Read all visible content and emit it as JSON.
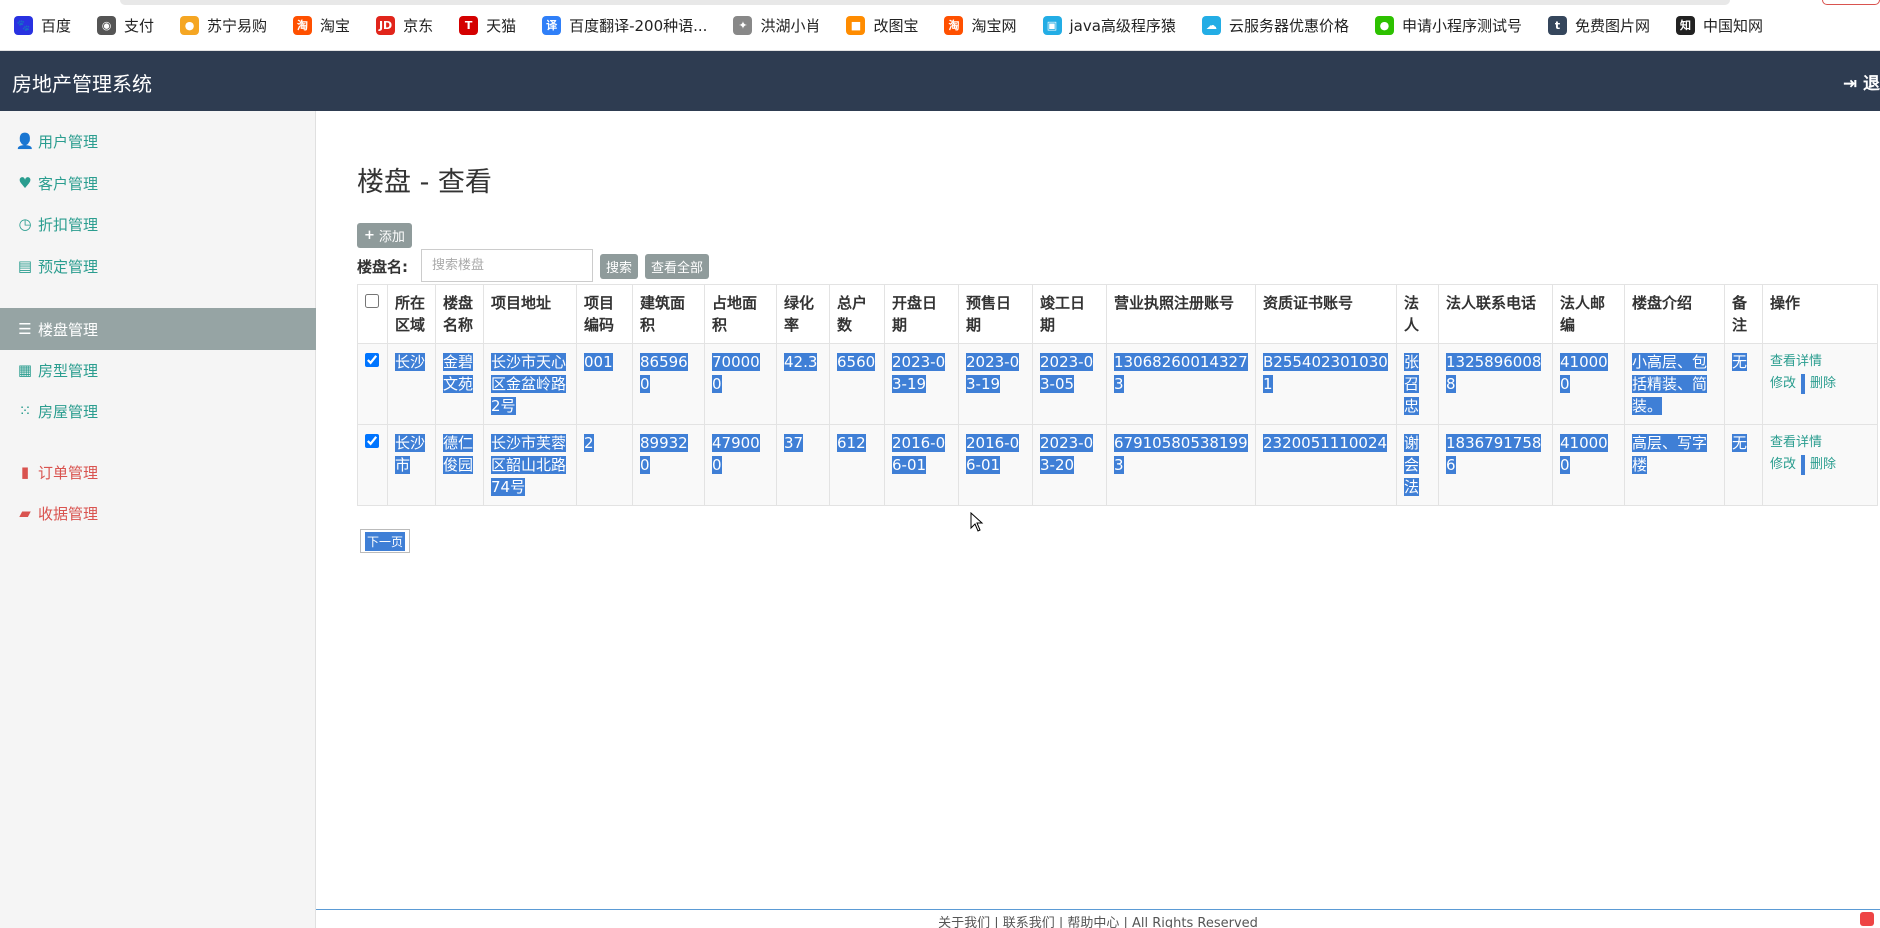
{
  "bookmarks": [
    {
      "label": "百度",
      "icon": "baidu-icon",
      "color": "#2932e1",
      "glyph": "🐾"
    },
    {
      "label": "支付",
      "icon": "globe-icon",
      "color": "#555555",
      "glyph": "◉"
    },
    {
      "label": "苏宁易购",
      "icon": "suning-icon",
      "color": "#f5a623",
      "glyph": "●"
    },
    {
      "label": "淘宝",
      "icon": "taobao-icon",
      "color": "#ff5000",
      "glyph": "淘"
    },
    {
      "label": "京东",
      "icon": "jd-icon",
      "color": "#e1251b",
      "glyph": "JD"
    },
    {
      "label": "天猫",
      "icon": "tmall-icon",
      "color": "#d40000",
      "glyph": "T"
    },
    {
      "label": "百度翻译-200种语...",
      "icon": "translate-icon",
      "color": "#2f7ff8",
      "glyph": "译"
    },
    {
      "label": "洪湖小肖",
      "icon": "ghost-icon",
      "color": "#888888",
      "glyph": "✦"
    },
    {
      "label": "改图宝",
      "icon": "gaitubao-icon",
      "color": "#ff8c00",
      "glyph": "■"
    },
    {
      "label": "淘宝网",
      "icon": "taobao2-icon",
      "color": "#ff5000",
      "glyph": "淘"
    },
    {
      "label": "java高级程序猿",
      "icon": "bilibili-icon",
      "color": "#23ade5",
      "glyph": "▣"
    },
    {
      "label": "云服务器优惠价格",
      "icon": "cloud-icon",
      "color": "#23ade5",
      "glyph": "☁"
    },
    {
      "label": "申请小程序测试号",
      "icon": "wechat-icon",
      "color": "#2dc100",
      "glyph": "●"
    },
    {
      "label": "免费图片网",
      "icon": "tumblr-icon",
      "color": "#35465c",
      "glyph": "t"
    },
    {
      "label": "中国知网",
      "icon": "cnki-icon",
      "color": "#222222",
      "glyph": "知"
    }
  ],
  "header": {
    "title": "房地产管理系统",
    "logout": "退"
  },
  "sidebar": {
    "items": [
      {
        "label": "用户管理",
        "icon": "user-icon",
        "glyph": "👤"
      },
      {
        "label": "客户管理",
        "icon": "heart-icon",
        "glyph": "♥"
      },
      {
        "label": "折扣管理",
        "icon": "clock-icon",
        "glyph": "◷"
      },
      {
        "label": "预定管理",
        "icon": "list-box-icon",
        "glyph": "▤"
      },
      {
        "label": "楼盘管理",
        "icon": "list-icon",
        "glyph": "☰"
      },
      {
        "label": "房型管理",
        "icon": "th-large-icon",
        "glyph": "▦"
      },
      {
        "label": "房屋管理",
        "icon": "th-icon",
        "glyph": "⁙"
      },
      {
        "label": "订单管理",
        "icon": "file-icon",
        "glyph": "▮"
      },
      {
        "label": "收据管理",
        "icon": "folder-open-icon",
        "glyph": "▰"
      }
    ]
  },
  "main": {
    "title": "楼盘 - 查看",
    "add_label": "添加",
    "search_label": "楼盘名:",
    "search_placeholder": "搜索楼盘",
    "search_button": "搜索",
    "view_all_button": "查看全部",
    "next_page": "下一页"
  },
  "table": {
    "columns": [
      "所在区域",
      "楼盘名称",
      "项目地址",
      "项目编码",
      "建筑面积",
      "占地面积",
      "绿化率",
      "总户数",
      "开盘日期",
      "预售日期",
      "竣工日期",
      "营业执照注册账号",
      "资质证书账号",
      "法人",
      "法人联系电话",
      "法人邮编",
      "楼盘介绍",
      "备注",
      "操作"
    ],
    "rows": [
      {
        "checked": true,
        "cells": [
          "长沙",
          "金碧文苑",
          "长沙市天心区金盆岭路2号",
          "001",
          "865960",
          "700000",
          "42.3",
          "6560",
          "2023-03-19",
          "2023-03-19",
          "2023-03-05",
          "130682600143273",
          "B2554023010301",
          "张召忠",
          "13258960088",
          "410000",
          "小高层、包括精装、简装。",
          "无"
        ],
        "actions": {
          "detail": "查看详情",
          "edit": "修改",
          "delete": "删除"
        }
      },
      {
        "checked": true,
        "cells": [
          "长沙市",
          "德仁俊园",
          "长沙市芙蓉区韶山北路74号",
          "2",
          "899320",
          "479000",
          "37",
          "612",
          "2016-06-01",
          "2016-06-01",
          "2023-03-20",
          "679105805381993",
          "2320051110024",
          "谢会法",
          "18367917586",
          "410000",
          "高层、写字楼",
          "无"
        ],
        "actions": {
          "detail": "查看详情",
          "edit": "修改",
          "delete": "删除"
        }
      }
    ]
  },
  "footer": "关于我们 | 联系我们 | 帮助中心 | All Rights Reserved"
}
